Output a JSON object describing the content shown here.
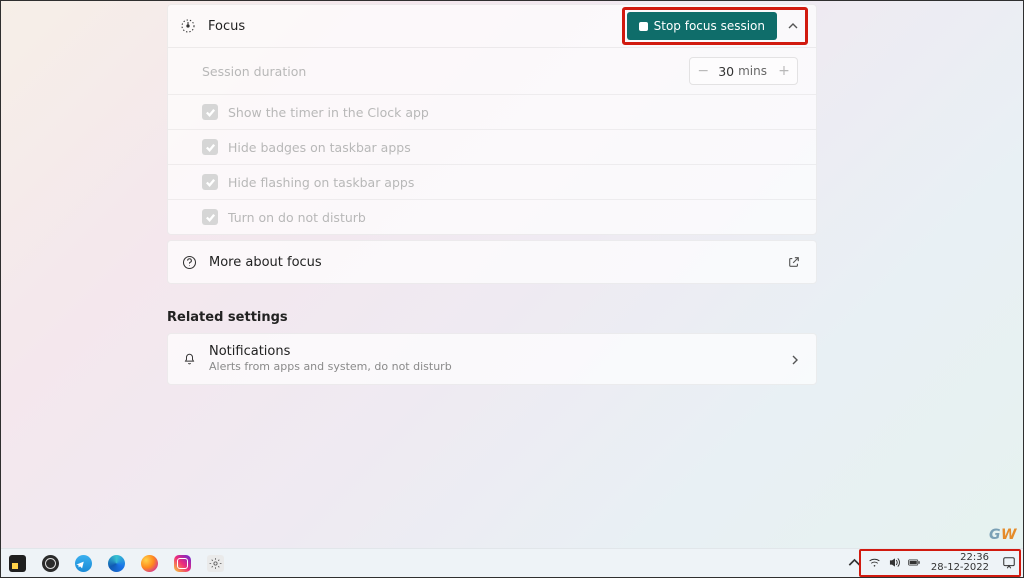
{
  "focus": {
    "title": "Focus",
    "stop_label": "Stop focus session",
    "duration_label": "Session duration",
    "duration_value": "30",
    "duration_unit": "mins",
    "options": [
      "Show the timer in the Clock app",
      "Hide badges on taskbar apps",
      "Hide flashing on taskbar apps",
      "Turn on do not disturb"
    ],
    "more_label": "More about focus"
  },
  "related": {
    "heading": "Related settings",
    "notifications": {
      "title": "Notifications",
      "subtitle": "Alerts from apps and system, do not disturb"
    }
  },
  "taskbar": {
    "time": "22:36",
    "date": "28-12-2022"
  },
  "watermark": "GW"
}
